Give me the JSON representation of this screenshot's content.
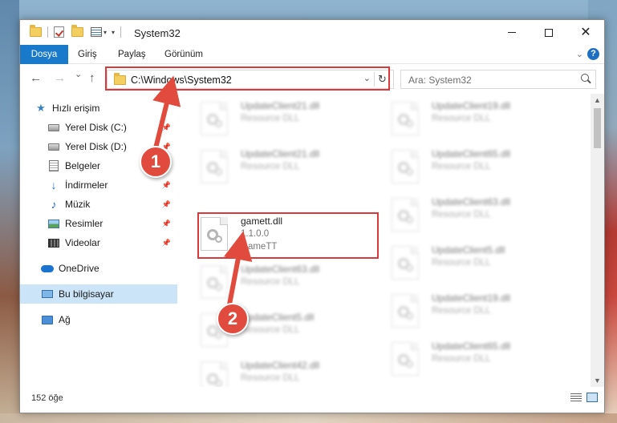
{
  "window": {
    "title": "System32",
    "minimize_icon": "minimize-icon",
    "maximize_icon": "maximize-icon",
    "close_glyph": "✕"
  },
  "ribbon": {
    "tabs": [
      "Dosya",
      "Giriş",
      "Paylaş",
      "Görünüm"
    ],
    "accent_color": "#1979ca",
    "help_glyph": "?"
  },
  "nav": {
    "back_glyph": "←",
    "forward_glyph": "→",
    "recent_glyph": "⌄",
    "up_glyph": "↑",
    "address": "C:\\Windows\\System32",
    "refresh_glyph": "↻",
    "search_placeholder": "Ara: System32"
  },
  "sidebar": {
    "items": [
      {
        "label": "Hızlı erişim",
        "icon": "star-icon"
      },
      {
        "label": "Yerel Disk (C:)",
        "icon": "disk-icon"
      },
      {
        "label": "Yerel Disk (D:)",
        "icon": "disk-icon"
      },
      {
        "label": "Belgeler",
        "icon": "documents-icon"
      },
      {
        "label": "İndirmeler",
        "icon": "download-icon"
      },
      {
        "label": "Müzik",
        "icon": "music-icon"
      },
      {
        "label": "Resimler",
        "icon": "pictures-icon"
      },
      {
        "label": "Videolar",
        "icon": "videos-icon"
      },
      {
        "label": "OneDrive",
        "icon": "onedrive-icon"
      },
      {
        "label": "Bu bilgisayar",
        "icon": "computer-icon"
      },
      {
        "label": "Ağ",
        "icon": "network-icon"
      }
    ]
  },
  "files": {
    "left": [
      {
        "name": "UpdateClient21.dll",
        "line2": "Resource DLL",
        "line3": ""
      },
      {
        "name": "UpdateClient21.dll",
        "line2": "Resource DLL",
        "line3": ""
      },
      {
        "name": "gamett.dll",
        "line2": "1.1.0.0",
        "line3": "GameTT"
      },
      {
        "name": "UpdateClient63.dll",
        "line2": "Resource DLL",
        "line3": ""
      },
      {
        "name": "UpdateClient5.dll",
        "line2": "Resource DLL",
        "line3": ""
      },
      {
        "name": "UpdateClient42.dll",
        "line2": "Resource DLL",
        "line3": ""
      }
    ],
    "right": [
      {
        "name": "UpdateClient19.dll",
        "line2": "Resource DLL"
      },
      {
        "name": "UpdateClient65.dll",
        "line2": "Resource DLL"
      },
      {
        "name": "UpdateClient63.dll",
        "line2": "Resource DLL"
      },
      {
        "name": "UpdateClient5.dll",
        "line2": "Resource DLL"
      },
      {
        "name": "UpdateClient19.dll",
        "line2": "Resource DLL"
      },
      {
        "name": "UpdateClient65.dll",
        "line2": "Resource DLL"
      }
    ]
  },
  "status": {
    "item_count": "152 öğe"
  },
  "callouts": {
    "one": "1",
    "two": "2",
    "highlight_color": "#d9393a"
  }
}
